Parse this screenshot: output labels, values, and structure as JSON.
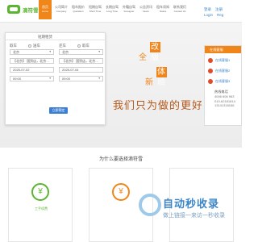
{
  "logo": {
    "text": "滴符雪"
  },
  "nav": [
    {
      "cn": "首页",
      "en": "Home",
      "active": true
    },
    {
      "cn": "公司简介",
      "en": "Company"
    },
    {
      "cn": "租车报价",
      "en": "Quotation"
    },
    {
      "cn": "短期自驾",
      "en": "Short Time"
    },
    {
      "cn": "长期自驾",
      "en": "Long Time"
    },
    {
      "cn": "外籍自驾",
      "en": "Foreigner"
    },
    {
      "cn": "公告资讯",
      "en": "News"
    },
    {
      "cn": "租车须知",
      "en": "Notice"
    },
    {
      "cn": "联系我们",
      "en": "Contact Us"
    }
  ],
  "auth": {
    "login": "登录",
    "register": "注册",
    "login_en": "Login",
    "register_en": "Reg"
  },
  "form": {
    "tab": "短期租赁",
    "pickup": {
      "label": "取车",
      "pickup_store_radio": "送车",
      "city": "北京",
      "store": "【北京】 国贸店，北京…",
      "date": "2025-07-02",
      "time": "09:00"
    },
    "return": {
      "label": "还车",
      "return_store_radio": "取车",
      "city": "北京",
      "store": "【北京】 国贸店，北京…",
      "date": "2025-07-04",
      "time": "09:00"
    },
    "submit": "立即预定"
  },
  "hero": {
    "line1_prefix": "全",
    "line1_box": "改版",
    "line2_prefix": "新",
    "line2_box": "体验",
    "slogan": "我们只为做的更好"
  },
  "sidebar": {
    "title": "在线客服",
    "qq": [
      "在线客服1",
      "在线客服2",
      "在线客服3"
    ],
    "hotline_label": "热线电话",
    "numbers": [
      "4006 606 963",
      "010-62181814",
      "13141318166"
    ]
  },
  "section": {
    "title": "为什么要选择滴符雪"
  },
  "cards": [
    {
      "icon": "¥",
      "label": "工手续费"
    },
    {
      "icon": "¥",
      "label": ""
    },
    {
      "icon": "",
      "label": ""
    }
  ],
  "watermark": {
    "main": "自动秒收录",
    "sub": "做上链接一来访一秒收录"
  },
  "colors": {
    "accent": "#f08519",
    "brand_green": "#5cb531",
    "link_blue": "#3b86c8"
  }
}
